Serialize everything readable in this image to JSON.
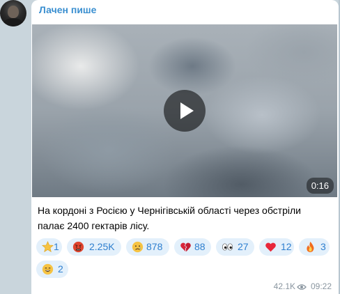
{
  "channel": {
    "author": "Лачен пише"
  },
  "post": {
    "video_duration": "0:16",
    "text": "На кордоні з Росією у Чернігівській області через обстріли палає 2400 гектарів лісу.",
    "views": "42.1K",
    "time": "09:22"
  },
  "reactions": [
    {
      "icon": "star-icon",
      "count": "1"
    },
    {
      "icon": "angry-face-icon",
      "count": "2.25K"
    },
    {
      "icon": "crying-face-icon",
      "count": "878"
    },
    {
      "icon": "broken-heart-icon",
      "count": "88"
    },
    {
      "icon": "eyes-icon",
      "count": "27"
    },
    {
      "icon": "red-heart-icon",
      "count": "12"
    },
    {
      "icon": "fire-icon",
      "count": "3"
    },
    {
      "icon": "grinning-face-icon",
      "count": "2"
    }
  ],
  "colors": {
    "author": "#3a8fd0",
    "reaction_bg": "#e3f0fb",
    "reaction_text": "#2e7fcf",
    "meta": "#8a96a0"
  }
}
